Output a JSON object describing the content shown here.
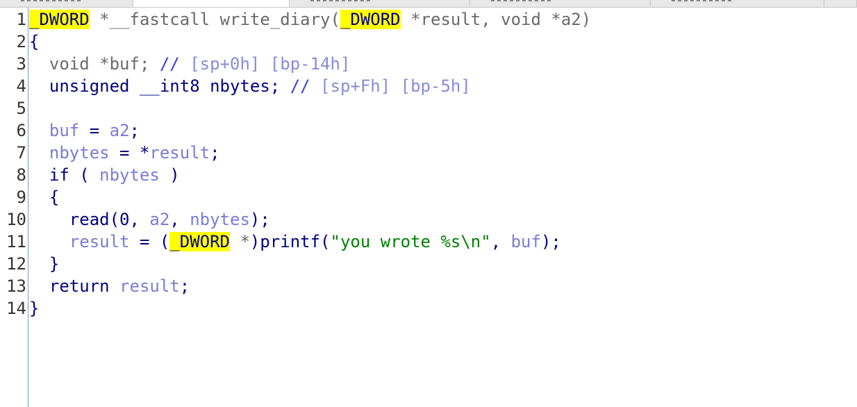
{
  "tabs": [
    {
      "label": ""
    },
    {
      "label": ""
    },
    {
      "label": ""
    },
    {
      "label": ""
    },
    {
      "label": ""
    }
  ],
  "lines": [
    {
      "num": "1",
      "tokens": [
        {
          "t": "_DWORD",
          "c": "hl"
        },
        {
          "t": " *__fastcall write_diary(",
          "c": "dim"
        },
        {
          "t": "_DWORD",
          "c": "hl"
        },
        {
          "t": " *result, void *a2)",
          "c": "dim"
        }
      ]
    },
    {
      "num": "2",
      "tokens": [
        {
          "t": "{",
          "c": "plain"
        }
      ]
    },
    {
      "num": "3",
      "tokens": [
        {
          "t": "  void *buf; ",
          "c": "dim"
        },
        {
          "t": "// ",
          "c": "cmt"
        },
        {
          "t": "[sp+0h] [bp-14h]",
          "c": "cmt-dim"
        }
      ]
    },
    {
      "num": "4",
      "tokens": [
        {
          "t": "  unsigned __int8 nbytes; ",
          "c": "plain"
        },
        {
          "t": "// ",
          "c": "cmt"
        },
        {
          "t": "[sp+Fh] [bp-5h]",
          "c": "cmt-dim"
        }
      ]
    },
    {
      "num": "5",
      "tokens": []
    },
    {
      "num": "6",
      "tokens": [
        {
          "t": "  ",
          "c": "plain"
        },
        {
          "t": "buf",
          "c": "var"
        },
        {
          "t": " = ",
          "c": "plain"
        },
        {
          "t": "a2",
          "c": "var"
        },
        {
          "t": ";",
          "c": "plain"
        }
      ]
    },
    {
      "num": "7",
      "tokens": [
        {
          "t": "  ",
          "c": "plain"
        },
        {
          "t": "nbytes",
          "c": "var"
        },
        {
          "t": " = *",
          "c": "plain"
        },
        {
          "t": "result",
          "c": "var"
        },
        {
          "t": ";",
          "c": "plain"
        }
      ]
    },
    {
      "num": "8",
      "tokens": [
        {
          "t": "  if ( ",
          "c": "plain"
        },
        {
          "t": "nbytes",
          "c": "var"
        },
        {
          "t": " )",
          "c": "plain"
        }
      ]
    },
    {
      "num": "9",
      "tokens": [
        {
          "t": "  {",
          "c": "plain"
        }
      ]
    },
    {
      "num": "10",
      "tokens": [
        {
          "t": "    read(0, ",
          "c": "plain"
        },
        {
          "t": "a2",
          "c": "var"
        },
        {
          "t": ", ",
          "c": "plain"
        },
        {
          "t": "nbytes",
          "c": "var"
        },
        {
          "t": ");",
          "c": "plain"
        }
      ]
    },
    {
      "num": "11",
      "tokens": [
        {
          "t": "    ",
          "c": "plain"
        },
        {
          "t": "result",
          "c": "var"
        },
        {
          "t": " = (",
          "c": "plain"
        },
        {
          "t": "_DWORD",
          "c": "hl"
        },
        {
          "t": " *",
          "c": "dim"
        },
        {
          "t": ")printf(",
          "c": "plain"
        },
        {
          "t": "\"you wrote %s\\n\"",
          "c": "str"
        },
        {
          "t": ", ",
          "c": "plain"
        },
        {
          "t": "buf",
          "c": "var"
        },
        {
          "t": ");",
          "c": "plain"
        }
      ]
    },
    {
      "num": "12",
      "tokens": [
        {
          "t": "  }",
          "c": "plain"
        }
      ]
    },
    {
      "num": "13",
      "tokens": [
        {
          "t": "  return ",
          "c": "plain"
        },
        {
          "t": "result",
          "c": "var"
        },
        {
          "t": ";",
          "c": "plain"
        }
      ]
    },
    {
      "num": "14",
      "tokens": [
        {
          "t": "}",
          "c": "plain"
        }
      ]
    }
  ]
}
